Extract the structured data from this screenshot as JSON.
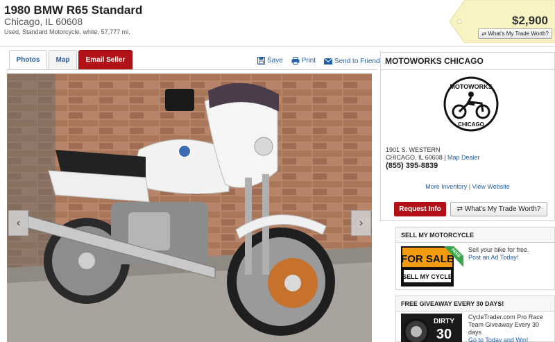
{
  "listing": {
    "title": "1980 BMW R65 Standard",
    "location": "Chicago, IL 60608",
    "summary": "Used, Standard Motorcycle, white, 57,777 mi.",
    "price": "$2,900",
    "trade_label": "What's My Trade Worth?"
  },
  "tabs": [
    "Photos",
    "Map",
    "Email Seller"
  ],
  "actions": {
    "save": "Save",
    "print": "Print",
    "send": "Send to Friend"
  },
  "gallery": {
    "prev": "‹",
    "next": "›"
  },
  "dealer": {
    "name": "MOTOWORKS CHICAGO",
    "logo_top": "MOTOWORKS",
    "logo_bottom": "CHICAGO",
    "address_line1": "1901 S. WESTERN",
    "address_line2": "CHICAGO, IL 60608",
    "map_link": "Map Dealer",
    "phone": "(855) 395-8839",
    "more_inventory": "More Inventory",
    "view_website": "View Website",
    "request_info": "Request Info",
    "trade_label": "What's My Trade Worth?"
  },
  "sell": {
    "title": "SELL MY MOTORCYCLE",
    "badge_top": "FOR SALE",
    "badge_bottom": "SELL MY CYCLE",
    "badge_ribbon": "FREE",
    "text": "Sell your bike for free.",
    "link": "Post an Ad Today!"
  },
  "giveaway": {
    "title": "FREE GIVEAWAY EVERY 30 DAYS!",
    "badge_line1": "DIRTY",
    "badge_line2": "30",
    "text": "CycleTrader.com Pro Race Team Giveaway Every 30 days",
    "link": "Go to Today and Win!"
  },
  "colors": {
    "accent_red": "#b21117",
    "link_blue": "#2460a7"
  }
}
